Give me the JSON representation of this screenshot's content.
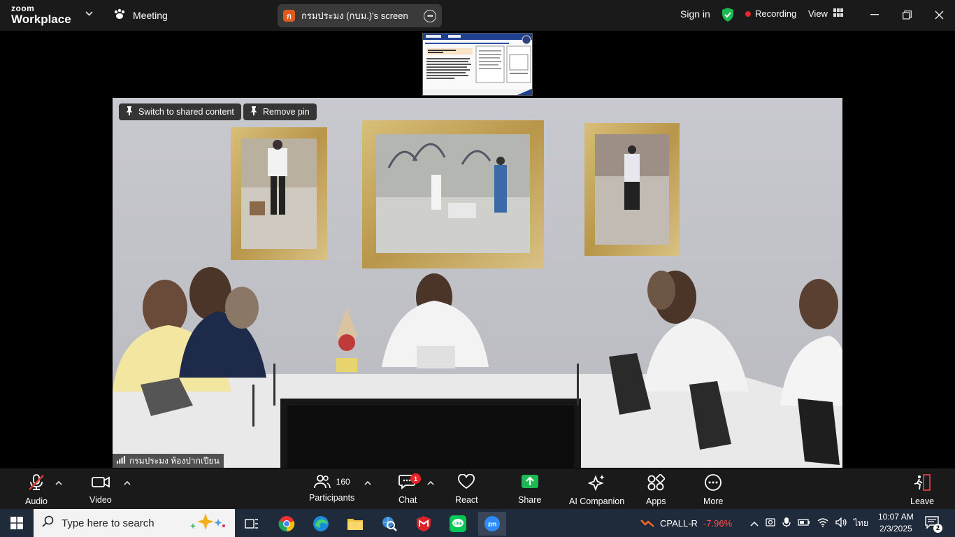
{
  "app": {
    "logo_top": "zoom",
    "logo_bottom": "Workplace",
    "meeting_label": "Meeting"
  },
  "share_pill": {
    "initial": "ก",
    "title": "กรมประมง (กบม.)'s screen"
  },
  "header": {
    "sign_in": "Sign in",
    "recording": "Recording",
    "view": "View"
  },
  "stage": {
    "switch_label": "Switch to shared content",
    "remove_pin_label": "Remove pin",
    "speaker_name": "กรมประมง ห้องปากเปียน"
  },
  "toolbar": {
    "audio": "Audio",
    "video": "Video",
    "participants_count": "160",
    "participants": "Participants",
    "chat": "Chat",
    "chat_badge": "1",
    "react": "React",
    "share": "Share",
    "ai_companion": "AI Companion",
    "apps": "Apps",
    "more": "More",
    "leave": "Leave"
  },
  "taskbar": {
    "search_placeholder": "Type here to search",
    "stock_ticker": "CPALL-R",
    "stock_change": "-7.96%",
    "language": "ไทย",
    "time": "10:07 AM",
    "date": "2/3/2025",
    "notifications": "2"
  },
  "colors": {
    "accent_green": "#1db954",
    "recording_red": "#e02828",
    "stock_red": "#ff4f4f",
    "topbar_bg": "#1a1a1a",
    "taskbar_bg": "#1f2a3a"
  }
}
